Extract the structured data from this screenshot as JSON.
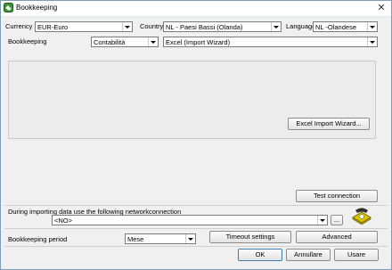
{
  "window": {
    "title": "Bookkeeping"
  },
  "currency": {
    "label": "Currency",
    "value": "EUR-Euro"
  },
  "country": {
    "label": "Country",
    "value": "NL - Paesi Bassi (Olanda)"
  },
  "language": {
    "label": "Language",
    "value": "NL -Olandese"
  },
  "bookkeeping": {
    "label": "Bookkeeping",
    "value": "Contabilità",
    "format": "Excel (Import Wizard)"
  },
  "panel": {
    "wizard_button": "Excel Import Wizard..."
  },
  "test_connection": "Test connection",
  "network": {
    "label": "During importing data use the following networkconnection",
    "value": "<NO>",
    "browse": "..."
  },
  "period": {
    "label": "Bookkeeping period",
    "value": "Mese"
  },
  "buttons": {
    "timeout": "Timeout settings",
    "advanced": "Advanced",
    "ok": "OK",
    "cancel": "Annullare",
    "use": "Usare"
  }
}
